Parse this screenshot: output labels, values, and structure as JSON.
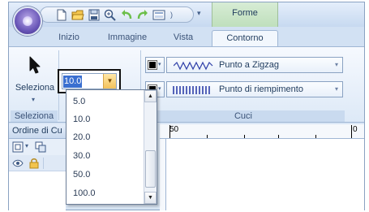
{
  "app": {
    "context_tab_title": "Forme"
  },
  "tabs": [
    {
      "label": "Inizio"
    },
    {
      "label": "Immagine"
    },
    {
      "label": "Vista"
    },
    {
      "label": "Contorno"
    }
  ],
  "ribbon": {
    "select_group": {
      "button_label": "Seleziona",
      "group_label": "Seleziona"
    },
    "sew_group": {
      "group_label": "Cuci",
      "width_combo_value": "10.0",
      "line_stitch": "Punto a Zigzag",
      "fill_stitch": "Punto di riempimento",
      "swatch_color": "#000000"
    }
  },
  "dropdown": {
    "options": [
      "5.0",
      "10.0",
      "20.0",
      "30.0",
      "50.0",
      "100.0"
    ]
  },
  "panel": {
    "title": "Ordine di Cu"
  },
  "ruler": {
    "labels": [
      "50",
      "0"
    ]
  },
  "colors": {
    "accent": "#3a6fd0",
    "ribbon_bg": "#dde9f7",
    "context_tab": "#c6e4c3"
  },
  "icons": [
    "app-orb-icon",
    "new-doc-icon",
    "open-folder-icon",
    "save-icon",
    "zoom-icon",
    "undo-icon",
    "redo-icon",
    "print-preview-icon",
    "arrow-cursor-icon",
    "lock-icon",
    "eye-icon"
  ]
}
